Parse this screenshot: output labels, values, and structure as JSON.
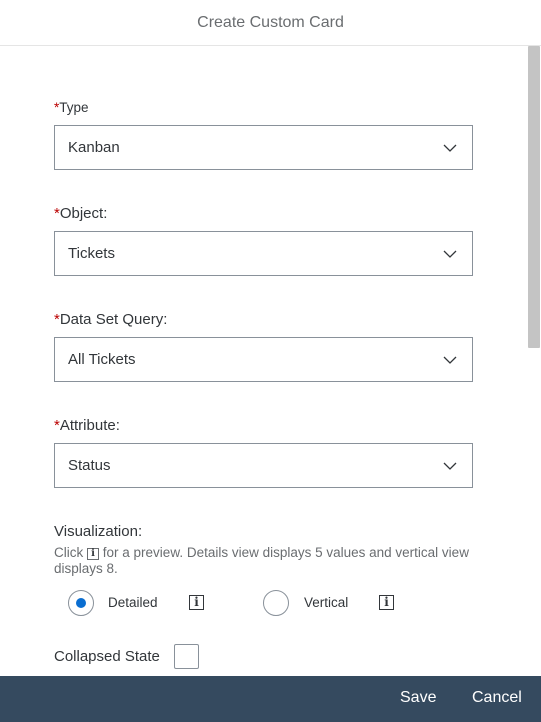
{
  "dialog": {
    "title": "Create Custom Card",
    "save_label": "Save",
    "cancel_label": "Cancel"
  },
  "form": {
    "required_marker": "*",
    "type": {
      "label": "Type",
      "value": "Kanban"
    },
    "object": {
      "label": "Object:",
      "value": "Tickets"
    },
    "query": {
      "label": "Data Set Query:",
      "value": "All Tickets"
    },
    "attribute": {
      "label": "Attribute:",
      "value": "Status"
    },
    "visualization": {
      "label": "Visualization:",
      "hint_before": "Click",
      "hint_after": "for a preview. Details view displays 5 values and vertical view displays 8.",
      "info_glyph": "i",
      "options": [
        {
          "label": "Detailed",
          "selected": true
        },
        {
          "label": "Vertical",
          "selected": false
        }
      ]
    },
    "collapsed_state": {
      "label": "Collapsed State",
      "checked": false
    }
  },
  "colors": {
    "accent": "#0a6ed1",
    "required": "#bb0000",
    "footer": "#354a5f"
  }
}
